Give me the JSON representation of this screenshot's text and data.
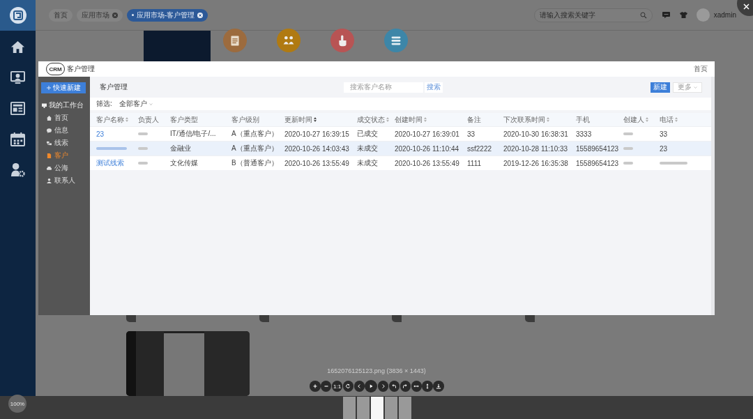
{
  "sidebar": {
    "items": [
      {
        "kind": "home"
      },
      {
        "kind": "monitor"
      },
      {
        "kind": "news"
      },
      {
        "kind": "calendar"
      },
      {
        "kind": "user-gear"
      }
    ]
  },
  "tabs": [
    {
      "label": "首页",
      "closable": false,
      "selected": false
    },
    {
      "label": "应用市场",
      "closable": true,
      "selected": false
    },
    {
      "label": "应用市场-客户管理",
      "closable": true,
      "selected": true
    }
  ],
  "search": {
    "placeholder": "请输入搜索关键字"
  },
  "user": {
    "name": "xadmin"
  },
  "app_tiles": [
    {
      "kind": "note",
      "color": "#9c6b3e"
    },
    {
      "kind": "people",
      "color": "#b07a12"
    },
    {
      "kind": "hand",
      "color": "#b85454"
    },
    {
      "kind": "list",
      "color": "#3d86a8"
    }
  ],
  "viewer": {
    "image": {
      "logo": "CRM",
      "title": "客户管理",
      "header_link": "首页",
      "new_button": "快速新建",
      "workspace": "我的工作台",
      "nav": [
        {
          "label": "首页",
          "kind": "home",
          "selected": false
        },
        {
          "label": "信息",
          "kind": "chat",
          "selected": false
        },
        {
          "label": "线索",
          "kind": "lead",
          "selected": false
        },
        {
          "label": "客户",
          "kind": "doc",
          "selected": true
        },
        {
          "label": "公海",
          "kind": "car",
          "selected": false
        },
        {
          "label": "联系人",
          "kind": "person",
          "selected": false
        }
      ],
      "page_title": "客户管理",
      "search": {
        "placeholder": "搜索客户名称",
        "button": "搜索"
      },
      "actions": [
        {
          "label": "新建",
          "kind": "primary"
        },
        {
          "label": "更多",
          "kind": "dropdown"
        }
      ],
      "filter": {
        "label": "筛选:",
        "value": "全部客户"
      },
      "table": {
        "columns": [
          {
            "label": "客户名称",
            "sortable": true,
            "sorted": false
          },
          {
            "label": "负责人",
            "sortable": false,
            "sorted": false
          },
          {
            "label": "客户类型",
            "sortable": false,
            "sorted": false
          },
          {
            "label": "客户级别",
            "sortable": false,
            "sorted": false
          },
          {
            "label": "更新时间",
            "sortable": true,
            "sorted": true
          },
          {
            "label": "成交状态",
            "sortable": true,
            "sorted": false
          },
          {
            "label": "创建时间",
            "sortable": true,
            "sorted": false
          },
          {
            "label": "备注",
            "sortable": false,
            "sorted": false
          },
          {
            "label": "下次联系时间",
            "sortable": true,
            "sorted": false
          },
          {
            "label": "手机",
            "sortable": false,
            "sorted": false
          },
          {
            "label": "创建人",
            "sortable": true,
            "sorted": false
          },
          {
            "label": "电话",
            "sortable": true,
            "sorted": false
          }
        ],
        "rows": [
          {
            "selected": false,
            "cells": [
              "23",
              {
                "kind": "blurred"
              },
              "IT/通信/电子/...",
              "A（重点客户）",
              "2020-10-27 16:39:15",
              "已成交",
              "2020-10-27 16:39:01",
              "33",
              "2020-10-30 16:38:31",
              "3333",
              {
                "kind": "blurred"
              },
              "33"
            ]
          },
          {
            "selected": true,
            "cells": [
              {
                "kind": "blurred"
              },
              {
                "kind": "blurred"
              },
              "金融业",
              "A（重点客户）",
              "2020-10-26 14:03:43",
              "未成交",
              "2020-10-26 11:10:44",
              "ssf2222",
              "2020-10-28 11:10:33",
              "15589654123",
              {
                "kind": "blurred"
              },
              "23"
            ]
          },
          {
            "selected": false,
            "cells": [
              "测试线索",
              {
                "kind": "blurred"
              },
              "文化传媒",
              "B（普通客户）",
              "2020-10-26 13:55:49",
              "未成交",
              "2020-10-26 13:55:49",
              "1111",
              "2019-12-26 16:35:38",
              "15589654123",
              {
                "kind": "blurred"
              },
              {
                "kind": "blurred"
              }
            ]
          }
        ]
      }
    },
    "filename": "1652076125123.png (3836 × 1443)",
    "toolbar": [
      {
        "kind": "zoom-in"
      },
      {
        "kind": "zoom-out"
      },
      {
        "kind": "actual-size",
        "label": "1:1"
      },
      {
        "kind": "reset"
      },
      {
        "kind": "prev"
      },
      {
        "kind": "play"
      },
      {
        "kind": "next"
      },
      {
        "kind": "rotate-left"
      },
      {
        "kind": "rotate-right"
      },
      {
        "kind": "flip-h"
      },
      {
        "kind": "flip-v"
      },
      {
        "kind": "download"
      }
    ],
    "thumbnails": [
      {
        "selected": false
      },
      {
        "selected": false
      },
      {
        "selected": true
      },
      {
        "selected": false
      },
      {
        "selected": false
      }
    ],
    "zoom": "100%"
  }
}
